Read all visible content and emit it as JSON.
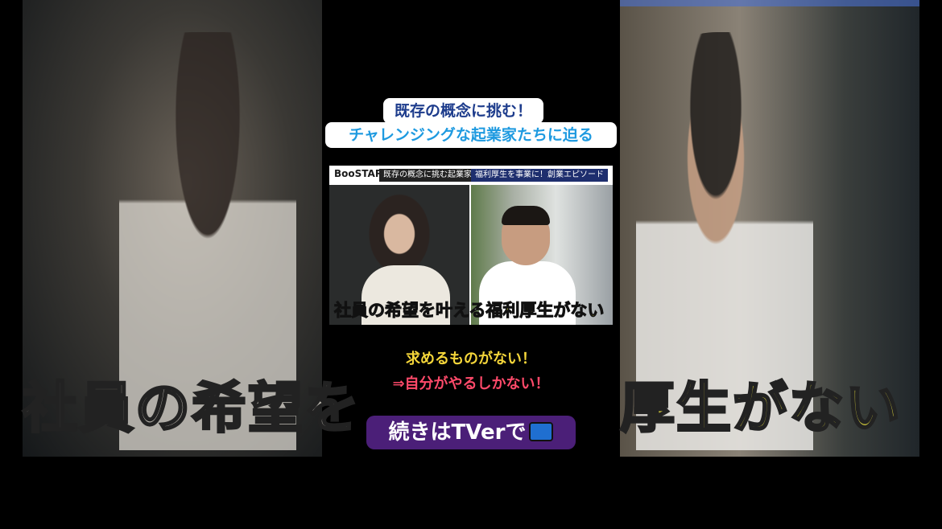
{
  "title_line1": "既存の概念に挑む！",
  "title_line2": "チャレンジングな起業家たちに迫る",
  "clip": {
    "logo": "BooSTAR",
    "label_left": "既存の概念に挑む起業家",
    "label_right": "福利厚生を事業に！創業エピソード",
    "caption_plain": "社員の希望を叶える",
    "caption_highlight": "福利厚生がない"
  },
  "background": {
    "left_caption": "社員の希望を",
    "right_caption": "厚生がない"
  },
  "note_line1": "求めるものがない！",
  "note_line2": "⇒自分がやるしかない！",
  "cta_label": "続きはTVerで",
  "colors": {
    "title1": "#1d3c8c",
    "title2": "#1e9ae0",
    "note1": "#f5d63a",
    "note2": "#ff4a6a",
    "cta_bg": "#4b1f78"
  }
}
